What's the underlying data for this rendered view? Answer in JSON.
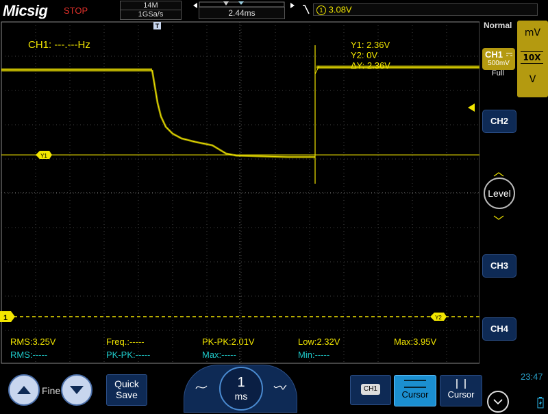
{
  "header": {
    "brand": "Micsig",
    "run_state": "STOP",
    "memory_depth": "14M",
    "sample_rate": "1GSa/s",
    "trigger_position_marker": "T",
    "time_offset": "2.44ms",
    "trigger_source": "1",
    "trigger_level": "3.08V"
  },
  "display": {
    "frequency_readout": "CH1: ---.---Hz",
    "cursor_y1_label": "Y1:",
    "cursor_y1_value": "2.36V",
    "cursor_y2_label": "Y2:",
    "cursor_y2_value": "0V",
    "cursor_dy_label": "ΔY:",
    "cursor_dy_value": "2.36V",
    "cursor_y1_marker": "Y1",
    "cursor_y2_marker": "Y2",
    "trigger_time_marker": "T",
    "ch1_ground_marker": "1"
  },
  "measurements": {
    "row1": [
      {
        "label": "RMS:",
        "value": "3.25V"
      },
      {
        "label": "Freq.:",
        "value": "-----"
      },
      {
        "label": "PK-PK:",
        "value": "2.01V"
      },
      {
        "label": "Low:",
        "value": "2.32V"
      },
      {
        "label": "Max:",
        "value": "3.95V"
      }
    ],
    "row2": [
      {
        "label": "RMS:",
        "value": "-----"
      },
      {
        "label": "PK-PK:",
        "value": "-----"
      },
      {
        "label": "Max:",
        "value": "-----"
      },
      {
        "label": "Min:",
        "value": "-----"
      }
    ]
  },
  "right_panel": {
    "trigger_mode": "Normal",
    "ch1_label": "CH1",
    "ch1_scale": "500mV",
    "ch1_bandwidth": "Full",
    "unit_mv": "mV",
    "probe_ratio": "10X",
    "unit_v": "V",
    "ch2_label": "CH2",
    "level_label": "Level",
    "ch3_label": "CH3",
    "ch4_label": "CH4"
  },
  "bottom": {
    "fine_label": "Fine",
    "quick_save_line1": "Quick",
    "quick_save_line2": "Save",
    "timebase_value": "1",
    "timebase_unit": "ms",
    "ch1_tag": "CH1",
    "cursor_h_label": "Cursor",
    "cursor_v_label": "Cursor",
    "clock": "23:47"
  },
  "colors": {
    "ch1": "#f2e600",
    "measure_secondary": "#1ec8c8",
    "button_blue": "#0e2a55",
    "run_state_red": "#e0302a"
  }
}
